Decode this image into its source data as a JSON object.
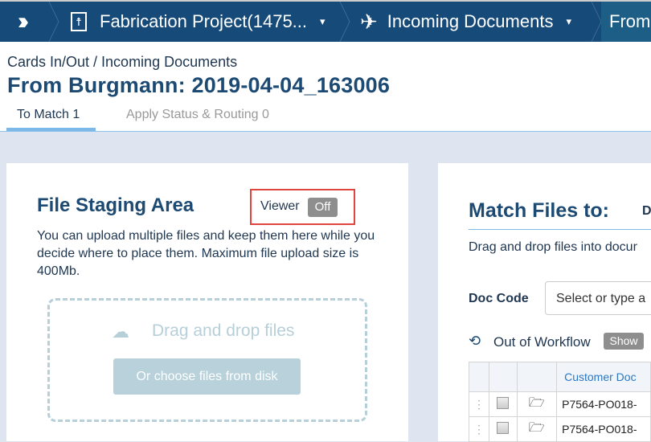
{
  "nav": {
    "items": [
      {
        "label": "Fabrication Project(1475..."
      },
      {
        "label": "Incoming Documents"
      },
      {
        "label": "From"
      }
    ]
  },
  "header": {
    "breadcrumb": "Cards In/Out / Incoming Documents",
    "title": "From Burgmann: 2019-04-04_163006",
    "tabs": [
      {
        "label": "To Match 1",
        "active": true
      },
      {
        "label": "Apply Status & Routing 0",
        "active": false
      }
    ]
  },
  "staging": {
    "title": "File Staging Area",
    "viewer_label": "Viewer",
    "viewer_toggle": "Off",
    "description": "You can upload multiple files and keep them here while you decide where to place them. Maximum file upload size is 400Mb.",
    "drop_text": "Drag and drop files",
    "choose_button": "Or choose files from disk"
  },
  "match": {
    "title": "Match Files to:",
    "title_extra": "D",
    "hint": "Drag and drop files into docur",
    "doc_code_label": "Doc Code",
    "doc_code_placeholder": "Select or type a",
    "out_of_workflow": "Out of Workflow",
    "show_button": "Show",
    "table": {
      "columns": [
        "",
        "",
        "",
        "Customer Doc"
      ],
      "rows": [
        {
          "doc": "P7564-PO018-"
        },
        {
          "doc": "P7564-PO018-"
        }
      ]
    }
  },
  "colors": {
    "nav": "#164a78",
    "accent": "#1c4a73",
    "highlight_box": "#e0443e"
  }
}
